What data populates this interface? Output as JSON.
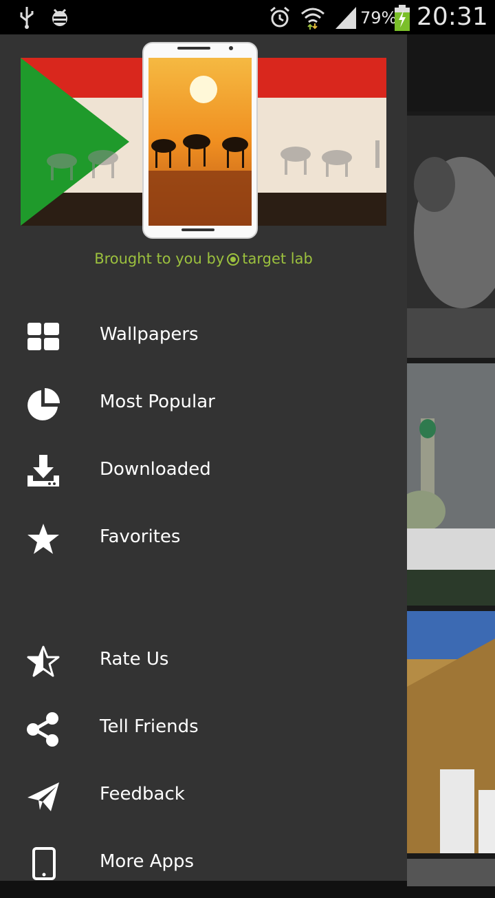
{
  "status_bar": {
    "battery_percent": "79%",
    "time": "20:31"
  },
  "drawer": {
    "credit": {
      "prefix": "Brought to you by",
      "brand": "target lab"
    },
    "primary_items": [
      {
        "label": "Wallpapers",
        "icon": "grid-icon"
      },
      {
        "label": "Most Popular",
        "icon": "pie-chart-icon"
      },
      {
        "label": "Downloaded",
        "icon": "download-icon"
      },
      {
        "label": "Favorites",
        "icon": "star-icon"
      }
    ],
    "secondary_items": [
      {
        "label": "Rate Us",
        "icon": "star-half-icon"
      },
      {
        "label": "Tell Friends",
        "icon": "share-icon"
      },
      {
        "label": "Feedback",
        "icon": "send-icon"
      },
      {
        "label": "More Apps",
        "icon": "tablet-icon"
      }
    ]
  },
  "colors": {
    "drawer_bg": "#333333",
    "accent": "#9cc13e",
    "flag_red": "#d9271d",
    "flag_green": "#1f9a2b"
  }
}
